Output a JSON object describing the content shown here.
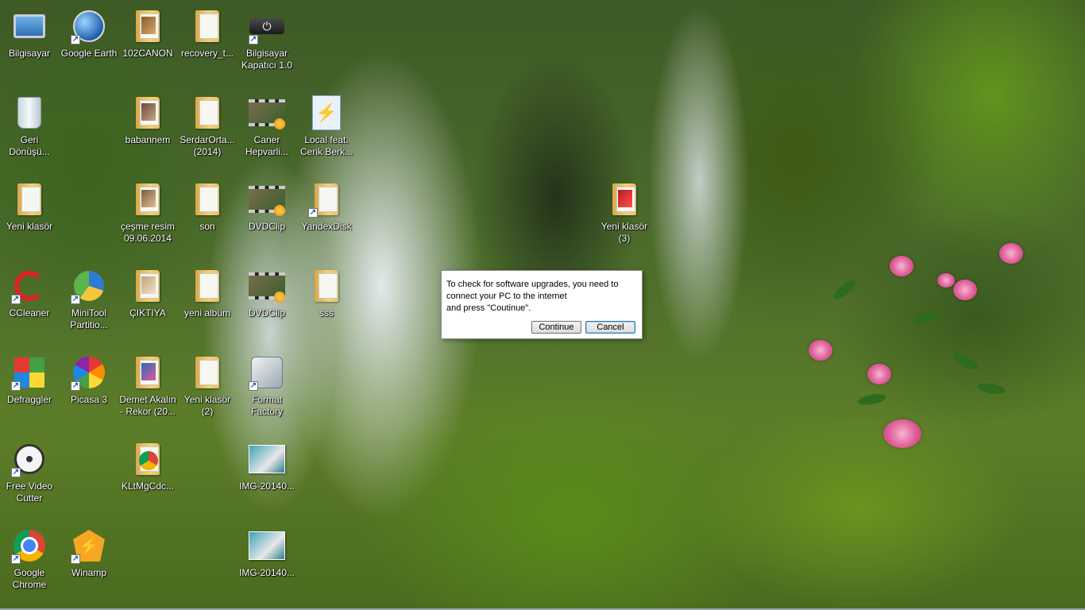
{
  "desktop": {
    "icons": [
      {
        "label": "Bilgisayar",
        "icon": "computer-icon"
      },
      {
        "label": "Google Earth",
        "icon": "google-earth-icon",
        "shortcut": true
      },
      {
        "label": "102CANON",
        "icon": "folder-icon"
      },
      {
        "label": "recovery_t...",
        "icon": "folder-icon"
      },
      {
        "label": "Bilgisayar\nKapatıcı 1.0",
        "icon": "power-icon",
        "shortcut": true
      },
      {
        "label": "Geri\nDönüşü...",
        "icon": "recycle-bin-icon"
      },
      {
        "label": "babannem",
        "icon": "folder-icon"
      },
      {
        "label": "SerdarOrta...\n(2014)",
        "icon": "folder-icon"
      },
      {
        "label": "Caner\nHepvarli...",
        "icon": "video-file-icon"
      },
      {
        "label": "Local feat.\nCerik Berk...",
        "icon": "media-file-icon"
      },
      {
        "label": "Yeni klasör",
        "icon": "folder-icon"
      },
      {
        "label": "çeşme resim\n09.06.2014",
        "icon": "folder-icon"
      },
      {
        "label": "son",
        "icon": "folder-icon"
      },
      {
        "label": "DVDClip",
        "icon": "video-file-icon"
      },
      {
        "label": "YandexDisk",
        "icon": "yandex-disk-icon",
        "shortcut": true
      },
      {
        "label": "Yeni klasör\n(3)",
        "icon": "folder-icon"
      },
      {
        "label": "CCleaner",
        "icon": "ccleaner-icon",
        "shortcut": true
      },
      {
        "label": "MiniTool\nPartitio...",
        "icon": "minitool-icon",
        "shortcut": true
      },
      {
        "label": "ÇIKTIYA",
        "icon": "folder-icon"
      },
      {
        "label": "yeni albüm",
        "icon": "folder-icon"
      },
      {
        "label": "DVDClip",
        "icon": "video-file-icon"
      },
      {
        "label": "sss",
        "icon": "folder-icon"
      },
      {
        "label": "Defraggler",
        "icon": "defraggler-icon",
        "shortcut": true
      },
      {
        "label": "Picasa 3",
        "icon": "picasa-icon",
        "shortcut": true
      },
      {
        "label": "Demet Akalın\n- Rekor (20...",
        "icon": "folder-icon"
      },
      {
        "label": "Yeni klasör\n(2)",
        "icon": "folder-icon"
      },
      {
        "label": "Format\nFactory",
        "icon": "format-factory-icon",
        "shortcut": true
      },
      {
        "label": "Free Video\nCutter",
        "icon": "free-video-cutter-icon",
        "shortcut": true
      },
      {
        "label": "KLtMgCdc...",
        "icon": "chrome-file-icon"
      },
      {
        "label": "IMG-20140...",
        "icon": "image-file-icon"
      },
      {
        "label": "Google\nChrome",
        "icon": "chrome-icon",
        "shortcut": true
      },
      {
        "label": "Winamp",
        "icon": "winamp-icon",
        "shortcut": true
      },
      {
        "label": "IMG-20140...",
        "icon": "image-file-icon"
      }
    ]
  },
  "dialog": {
    "message": "To check for software upgrades, you need to\nconnect your  PC to the internet\nand press \"Coutinue\".",
    "continue_label": "Continue",
    "cancel_label": "Cancel"
  },
  "shortcut_arrow": "↗"
}
